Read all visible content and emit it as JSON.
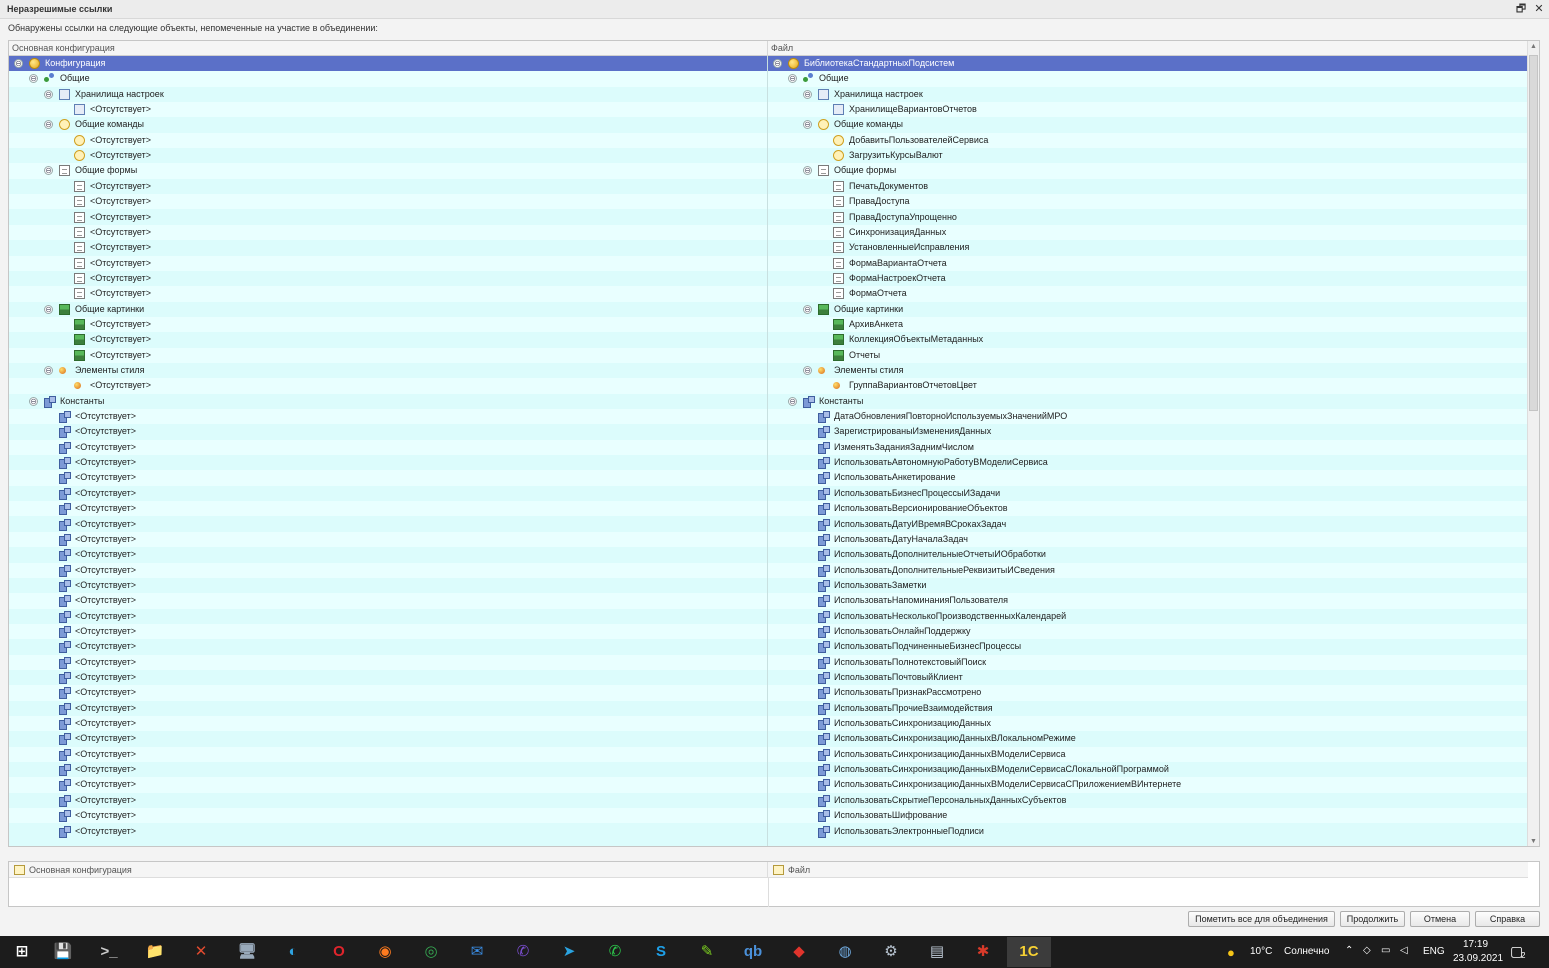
{
  "window": {
    "title": "Неразрешимые ссылки",
    "restore_glyph": "🗗",
    "close_glyph": "✕"
  },
  "message": "Обнаружены ссылки на следующие  объекты, непомеченные на участие в объединении:",
  "columns": {
    "left": "Основная конфигурация",
    "right": "Файл"
  },
  "tree": {
    "left": [
      {
        "indent": 0,
        "toggle": "⊖",
        "icon": "configuration-icon",
        "label": "Конфигурация",
        "selected": true
      },
      {
        "indent": 1,
        "toggle": "⊖",
        "icon": "common-icon",
        "label": "Общие"
      },
      {
        "indent": 2,
        "toggle": "⊖",
        "icon": "settings-storage-icon",
        "label": "Хранилища настроек"
      },
      {
        "indent": 3,
        "icon": "settings-storage-icon",
        "label": "<Отсутствует>"
      },
      {
        "indent": 2,
        "toggle": "⊖",
        "icon": "command-icon",
        "label": "Общие команды"
      },
      {
        "indent": 3,
        "icon": "command-icon",
        "label": "<Отсутствует>"
      },
      {
        "indent": 3,
        "icon": "command-icon",
        "label": "<Отсутствует>"
      },
      {
        "indent": 2,
        "toggle": "⊖",
        "icon": "form-icon",
        "label": "Общие формы"
      },
      {
        "indent": 3,
        "icon": "form-icon",
        "label": "<Отсутствует>"
      },
      {
        "indent": 3,
        "icon": "form-icon",
        "label": "<Отсутствует>"
      },
      {
        "indent": 3,
        "icon": "form-icon",
        "label": "<Отсутствует>"
      },
      {
        "indent": 3,
        "icon": "form-icon",
        "label": "<Отсутствует>"
      },
      {
        "indent": 3,
        "icon": "form-icon",
        "label": "<Отсутствует>"
      },
      {
        "indent": 3,
        "icon": "form-icon",
        "label": "<Отсутствует>"
      },
      {
        "indent": 3,
        "icon": "form-icon",
        "label": "<Отсутствует>"
      },
      {
        "indent": 3,
        "icon": "form-icon",
        "label": "<Отсутствует>"
      },
      {
        "indent": 2,
        "toggle": "⊖",
        "icon": "picture-icon",
        "label": "Общие картинки"
      },
      {
        "indent": 3,
        "icon": "picture-icon",
        "label": "<Отсутствует>"
      },
      {
        "indent": 3,
        "icon": "picture-icon",
        "label": "<Отсутствует>"
      },
      {
        "indent": 3,
        "icon": "picture-icon",
        "label": "<Отсутствует>"
      },
      {
        "indent": 2,
        "toggle": "⊖",
        "icon": "style-element-icon",
        "label": "Элементы стиля"
      },
      {
        "indent": 3,
        "icon": "style-element-icon",
        "label": "<Отсутствует>"
      },
      {
        "indent": 1,
        "toggle": "⊖",
        "icon": "constant-icon",
        "label": "Константы"
      },
      {
        "indent": 2,
        "icon": "constant-icon",
        "label": "<Отсутствует>"
      },
      {
        "indent": 2,
        "icon": "constant-icon",
        "label": "<Отсутствует>"
      },
      {
        "indent": 2,
        "icon": "constant-icon",
        "label": "<Отсутствует>"
      },
      {
        "indent": 2,
        "icon": "constant-icon",
        "label": "<Отсутствует>"
      },
      {
        "indent": 2,
        "icon": "constant-icon",
        "label": "<Отсутствует>"
      },
      {
        "indent": 2,
        "icon": "constant-icon",
        "label": "<Отсутствует>"
      },
      {
        "indent": 2,
        "icon": "constant-icon",
        "label": "<Отсутствует>"
      },
      {
        "indent": 2,
        "icon": "constant-icon",
        "label": "<Отсутствует>"
      },
      {
        "indent": 2,
        "icon": "constant-icon",
        "label": "<Отсутствует>"
      },
      {
        "indent": 2,
        "icon": "constant-icon",
        "label": "<Отсутствует>"
      },
      {
        "indent": 2,
        "icon": "constant-icon",
        "label": "<Отсутствует>"
      },
      {
        "indent": 2,
        "icon": "constant-icon",
        "label": "<Отсутствует>"
      },
      {
        "indent": 2,
        "icon": "constant-icon",
        "label": "<Отсутствует>"
      },
      {
        "indent": 2,
        "icon": "constant-icon",
        "label": "<Отсутствует>"
      },
      {
        "indent": 2,
        "icon": "constant-icon",
        "label": "<Отсутствует>"
      },
      {
        "indent": 2,
        "icon": "constant-icon",
        "label": "<Отсутствует>"
      },
      {
        "indent": 2,
        "icon": "constant-icon",
        "label": "<Отсутствует>"
      },
      {
        "indent": 2,
        "icon": "constant-icon",
        "label": "<Отсутствует>"
      },
      {
        "indent": 2,
        "icon": "constant-icon",
        "label": "<Отсутствует>"
      },
      {
        "indent": 2,
        "icon": "constant-icon",
        "label": "<Отсутствует>"
      },
      {
        "indent": 2,
        "icon": "constant-icon",
        "label": "<Отсутствует>"
      },
      {
        "indent": 2,
        "icon": "constant-icon",
        "label": "<Отсутствует>"
      },
      {
        "indent": 2,
        "icon": "constant-icon",
        "label": "<Отсутствует>"
      },
      {
        "indent": 2,
        "icon": "constant-icon",
        "label": "<Отсутствует>"
      },
      {
        "indent": 2,
        "icon": "constant-icon",
        "label": "<Отсутствует>"
      },
      {
        "indent": 2,
        "icon": "constant-icon",
        "label": "<Отсутствует>"
      },
      {
        "indent": 2,
        "icon": "constant-icon",
        "label": "<Отсутствует>"
      },
      {
        "indent": 2,
        "icon": "constant-icon",
        "label": "<Отсутствует>"
      }
    ],
    "right": [
      {
        "indent": 0,
        "toggle": "⊖",
        "icon": "configuration-icon",
        "label": "БиблиотекаСтандартныхПодсистем",
        "selected": true
      },
      {
        "indent": 1,
        "toggle": "⊖",
        "icon": "common-icon",
        "label": "Общие"
      },
      {
        "indent": 2,
        "toggle": "⊖",
        "icon": "settings-storage-icon",
        "label": "Хранилища настроек"
      },
      {
        "indent": 3,
        "icon": "settings-storage-icon",
        "label": "ХранилищеВариантовОтчетов"
      },
      {
        "indent": 2,
        "toggle": "⊖",
        "icon": "command-icon",
        "label": "Общие команды"
      },
      {
        "indent": 3,
        "icon": "command-icon",
        "label": "ДобавитьПользователейСервиса"
      },
      {
        "indent": 3,
        "icon": "command-icon",
        "label": "ЗагрузитьКурсыВалют"
      },
      {
        "indent": 2,
        "toggle": "⊖",
        "icon": "form-icon",
        "label": "Общие формы"
      },
      {
        "indent": 3,
        "icon": "form-icon",
        "label": "ПечатьДокументов"
      },
      {
        "indent": 3,
        "icon": "form-icon",
        "label": "ПраваДоступа"
      },
      {
        "indent": 3,
        "icon": "form-icon",
        "label": "ПраваДоступаУпрощенно"
      },
      {
        "indent": 3,
        "icon": "form-icon",
        "label": "СинхронизацияДанных"
      },
      {
        "indent": 3,
        "icon": "form-icon",
        "label": "УстановленныеИсправления"
      },
      {
        "indent": 3,
        "icon": "form-icon",
        "label": "ФормаВариантаОтчета"
      },
      {
        "indent": 3,
        "icon": "form-icon",
        "label": "ФормаНастроекОтчета"
      },
      {
        "indent": 3,
        "icon": "form-icon",
        "label": "ФормаОтчета"
      },
      {
        "indent": 2,
        "toggle": "⊖",
        "icon": "picture-icon",
        "label": "Общие картинки"
      },
      {
        "indent": 3,
        "icon": "picture-icon",
        "label": "АрхивАнкета"
      },
      {
        "indent": 3,
        "icon": "picture-icon",
        "label": "КоллекцияОбъектыМетаданных"
      },
      {
        "indent": 3,
        "icon": "picture-icon",
        "label": "Отчеты"
      },
      {
        "indent": 2,
        "toggle": "⊖",
        "icon": "style-element-icon",
        "label": "Элементы стиля"
      },
      {
        "indent": 3,
        "icon": "style-element-icon",
        "label": "ГруппаВариантовОтчетовЦвет"
      },
      {
        "indent": 1,
        "toggle": "⊖",
        "icon": "constant-icon",
        "label": "Константы"
      },
      {
        "indent": 2,
        "icon": "constant-icon",
        "label": "ДатаОбновленияПовторноИспользуемыхЗначенийМРО"
      },
      {
        "indent": 2,
        "icon": "constant-icon",
        "label": "ЗарегистрированыИзмененияДанных"
      },
      {
        "indent": 2,
        "icon": "constant-icon",
        "label": "ИзменятьЗаданияЗаднимЧислом"
      },
      {
        "indent": 2,
        "icon": "constant-icon",
        "label": "ИспользоватьАвтономнуюРаботуВМоделиСервиса"
      },
      {
        "indent": 2,
        "icon": "constant-icon",
        "label": "ИспользоватьАнкетирование"
      },
      {
        "indent": 2,
        "icon": "constant-icon",
        "label": "ИспользоватьБизнесПроцессыИЗадачи"
      },
      {
        "indent": 2,
        "icon": "constant-icon",
        "label": "ИспользоватьВерсионированиеОбъектов"
      },
      {
        "indent": 2,
        "icon": "constant-icon",
        "label": "ИспользоватьДатуИВремяВСрокахЗадач"
      },
      {
        "indent": 2,
        "icon": "constant-icon",
        "label": "ИспользоватьДатуНачалаЗадач"
      },
      {
        "indent": 2,
        "icon": "constant-icon",
        "label": "ИспользоватьДополнительныеОтчетыИОбработки"
      },
      {
        "indent": 2,
        "icon": "constant-icon",
        "label": "ИспользоватьДополнительныеРеквизитыИСведения"
      },
      {
        "indent": 2,
        "icon": "constant-icon",
        "label": "ИспользоватьЗаметки"
      },
      {
        "indent": 2,
        "icon": "constant-icon",
        "label": "ИспользоватьНапоминанияПользователя"
      },
      {
        "indent": 2,
        "icon": "constant-icon",
        "label": "ИспользоватьНесколькоПроизводственныхКалендарей"
      },
      {
        "indent": 2,
        "icon": "constant-icon",
        "label": "ИспользоватьОнлайнПоддержку"
      },
      {
        "indent": 2,
        "icon": "constant-icon",
        "label": "ИспользоватьПодчиненныеБизнесПроцессы"
      },
      {
        "indent": 2,
        "icon": "constant-icon",
        "label": "ИспользоватьПолнотекстовыйПоиск"
      },
      {
        "indent": 2,
        "icon": "constant-icon",
        "label": "ИспользоватьПочтовыйКлиент"
      },
      {
        "indent": 2,
        "icon": "constant-icon",
        "label": "ИспользоватьПризнакРассмотрено"
      },
      {
        "indent": 2,
        "icon": "constant-icon",
        "label": "ИспользоватьПрочиеВзаимодействия"
      },
      {
        "indent": 2,
        "icon": "constant-icon",
        "label": "ИспользоватьСинхронизациюДанных"
      },
      {
        "indent": 2,
        "icon": "constant-icon",
        "label": "ИспользоватьСинхронизациюДанныхВЛокальномРежиме"
      },
      {
        "indent": 2,
        "icon": "constant-icon",
        "label": "ИспользоватьСинхронизациюДанныхВМоделиСервиса"
      },
      {
        "indent": 2,
        "icon": "constant-icon",
        "label": "ИспользоватьСинхронизациюДанныхВМоделиСервисаСЛокальнойПрограммой"
      },
      {
        "indent": 2,
        "icon": "constant-icon",
        "label": "ИспользоватьСинхронизациюДанныхВМоделиСервисаСПриложениемВИнтернете"
      },
      {
        "indent": 2,
        "icon": "constant-icon",
        "label": "ИспользоватьСкрытиеПерсональныхДанныхСубъектов"
      },
      {
        "indent": 2,
        "icon": "constant-icon",
        "label": "ИспользоватьШифрование"
      },
      {
        "indent": 2,
        "icon": "constant-icon",
        "label": "ИспользоватьЭлектронныеПодписи"
      }
    ]
  },
  "bottom": {
    "left_title": "Основная конфигурация",
    "right_title": "Файл"
  },
  "buttons": {
    "mark_all": "Пометить все для объединения",
    "continue": "Продолжить",
    "cancel": "Отмена",
    "help": "Справка"
  },
  "taskbar": {
    "apps": [
      {
        "name": "start-icon",
        "glyph": "⊞",
        "color": "#ffffff"
      },
      {
        "name": "save-app-icon",
        "glyph": "💾",
        "color": "#3a6fd8"
      },
      {
        "name": "terminal-app-icon",
        "glyph": ">_",
        "color": "#cccccc"
      },
      {
        "name": "explorer-app-icon",
        "glyph": "📁",
        "color": "#f2c14e"
      },
      {
        "name": "remote-app-icon",
        "glyph": "✕",
        "color": "#e04a2f"
      },
      {
        "name": "monitor-app-icon",
        "glyph": "🖥",
        "color": "#9ab"
      },
      {
        "name": "edge-app-icon",
        "glyph": "◐",
        "color": "#2fa3e0"
      },
      {
        "name": "opera-app-icon",
        "glyph": "O",
        "color": "#e0252c"
      },
      {
        "name": "firefox-app-icon",
        "glyph": "◉",
        "color": "#ff7b1f"
      },
      {
        "name": "chrome-app-icon",
        "glyph": "◎",
        "color": "#36a852"
      },
      {
        "name": "mail-app-icon",
        "glyph": "✉",
        "color": "#3a8ee6"
      },
      {
        "name": "viber-app-icon",
        "glyph": "✆",
        "color": "#7b4ed0"
      },
      {
        "name": "telegram-app-icon",
        "glyph": "➤",
        "color": "#2aa3e0"
      },
      {
        "name": "whatsapp-app-icon",
        "glyph": "✆",
        "color": "#2cc44a"
      },
      {
        "name": "skype-app-icon",
        "glyph": "S",
        "color": "#1ea0e8"
      },
      {
        "name": "tools-app-icon",
        "glyph": "✎",
        "color": "#7ed321"
      },
      {
        "name": "qbittorrent-app-icon",
        "glyph": "qb",
        "color": "#4a90d9"
      },
      {
        "name": "anydesk-app-icon",
        "glyph": "◆",
        "color": "#e0342c"
      },
      {
        "name": "network-app-icon",
        "glyph": "◍",
        "color": "#6fa8dc"
      },
      {
        "name": "settings-app-icon",
        "glyph": "⚙",
        "color": "#b7c3d0"
      },
      {
        "name": "pdf-app-icon",
        "glyph": "▤",
        "color": "#c0cbd8"
      },
      {
        "name": "tool-red-app-icon",
        "glyph": "✱",
        "color": "#d83a2a"
      },
      {
        "name": "1c-app-icon",
        "glyph": "1С",
        "color": "#f5d033"
      }
    ],
    "weather_temp": "10°C",
    "weather_text": "Солнечно",
    "lang": "ENG",
    "time": "17:19",
    "date": "23.09.2021",
    "notif_count": "2"
  }
}
